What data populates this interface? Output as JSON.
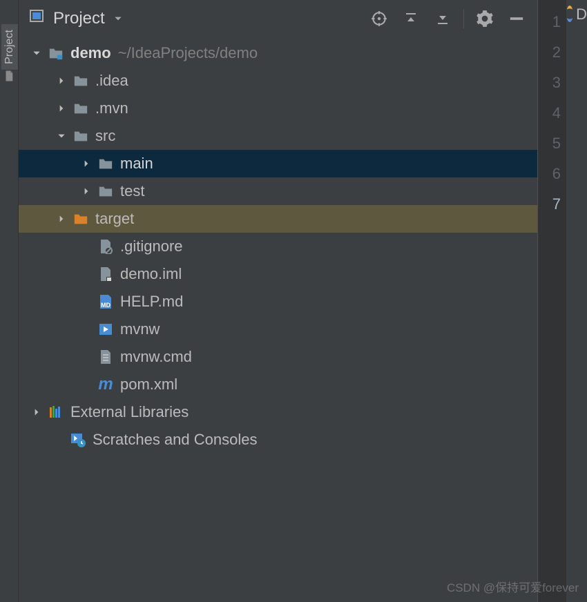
{
  "leftTabLabel": "Project",
  "header": {
    "title": "Project"
  },
  "tree": [
    {
      "id": "demo",
      "depth": 0,
      "arrow": "down",
      "icon": "module",
      "label": "demo",
      "bold": true,
      "extra": "~/IdeaProjects/demo"
    },
    {
      "id": "idea",
      "depth": 1,
      "arrow": "right",
      "icon": "folder",
      "label": ".idea"
    },
    {
      "id": "mvn",
      "depth": 1,
      "arrow": "right",
      "icon": "folder",
      "label": ".mvn"
    },
    {
      "id": "src",
      "depth": 1,
      "arrow": "down",
      "icon": "folder",
      "label": "src"
    },
    {
      "id": "main",
      "depth": 2,
      "arrow": "right",
      "icon": "folder",
      "label": "main",
      "rowClass": "selected-dark"
    },
    {
      "id": "test",
      "depth": 2,
      "arrow": "right",
      "icon": "folder",
      "label": "test"
    },
    {
      "id": "target",
      "depth": 1,
      "arrow": "right",
      "icon": "folder-orange",
      "label": "target",
      "rowClass": "selected-brown"
    },
    {
      "id": "gitignore",
      "depth": 2,
      "arrow": "none",
      "icon": "file-ignore",
      "label": ".gitignore"
    },
    {
      "id": "demoiml",
      "depth": 2,
      "arrow": "none",
      "icon": "file-iml",
      "label": "demo.iml"
    },
    {
      "id": "helpmd",
      "depth": 2,
      "arrow": "none",
      "icon": "file-md",
      "label": "HELP.md"
    },
    {
      "id": "mvnw",
      "depth": 2,
      "arrow": "none",
      "icon": "file-run",
      "label": "mvnw"
    },
    {
      "id": "mvnwcmd",
      "depth": 2,
      "arrow": "none",
      "icon": "file-txt",
      "label": "mvnw.cmd"
    },
    {
      "id": "pom",
      "depth": 2,
      "arrow": "none",
      "icon": "maven",
      "label": "pom.xml"
    },
    {
      "id": "extlib",
      "depth": 0,
      "arrow": "right",
      "icon": "libraries",
      "label": "External Libraries"
    },
    {
      "id": "scratch",
      "depth": 0,
      "arrow": "none",
      "icon": "scratch",
      "label": "Scratches and Consoles",
      "leftPad": true
    }
  ],
  "gutter": {
    "lines": [
      "1",
      "2",
      "3",
      "4",
      "5",
      "6",
      "7"
    ],
    "currentIndex": 6
  },
  "editorTab": "D",
  "watermark": "CSDN @保持可爱forever"
}
